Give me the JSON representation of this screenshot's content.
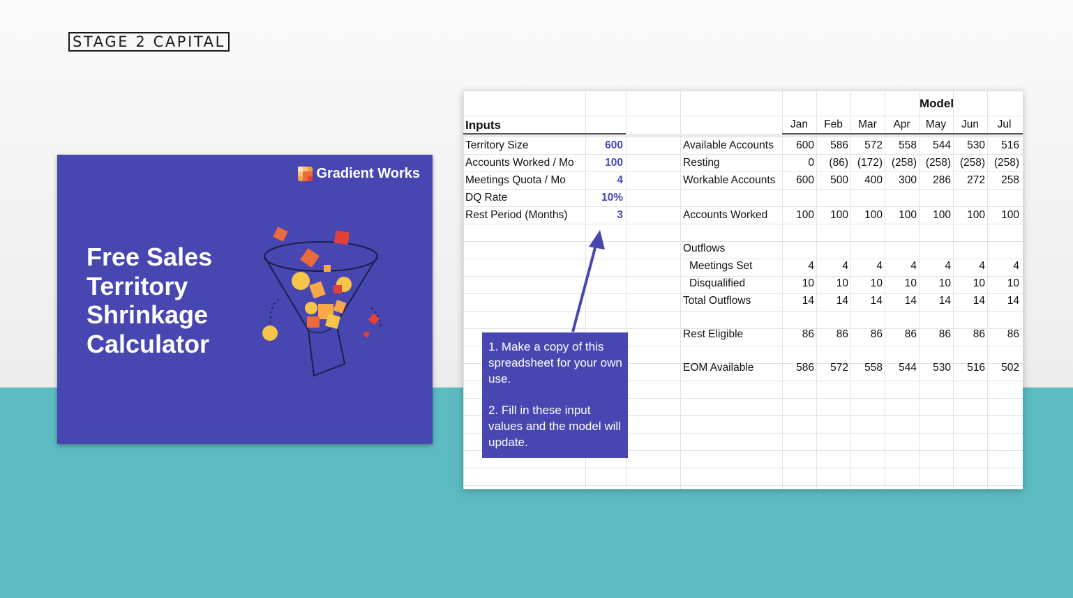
{
  "brand": {
    "logo_text": "STAGE 2 CAPITAL"
  },
  "card": {
    "brand_name": "Gradient Works",
    "title_lines": [
      "Free Sales",
      "Territory",
      "Shrinkage",
      "Calculator"
    ],
    "icons": [
      "gradient-works-logo-icon",
      "funnel-illustration"
    ],
    "background_color": "#4846b0"
  },
  "sheet": {
    "inputs_header": "Inputs",
    "model_header": "Model",
    "inputs": [
      {
        "label": "Territory Size",
        "value": "600"
      },
      {
        "label": "Accounts Worked / Mo",
        "value": "100"
      },
      {
        "label": "Meetings Quota / Mo",
        "value": "4"
      },
      {
        "label": "DQ Rate",
        "value": "10%"
      },
      {
        "label": "Rest Period (Months)",
        "value": "3"
      }
    ],
    "months": [
      "Jan",
      "Feb",
      "Mar",
      "Apr",
      "May",
      "Jun",
      "Jul"
    ],
    "model_rows": [
      {
        "label": "Available Accounts",
        "indent": false,
        "values": [
          "600",
          "586",
          "572",
          "558",
          "544",
          "530",
          "516"
        ]
      },
      {
        "label": "Resting",
        "indent": false,
        "values": [
          "0",
          "(86)",
          "(172)",
          "(258)",
          "(258)",
          "(258)",
          "(258)"
        ]
      },
      {
        "label": "Workable Accounts",
        "indent": false,
        "values": [
          "600",
          "500",
          "400",
          "300",
          "286",
          "272",
          "258"
        ]
      },
      {
        "label": "Accounts Worked",
        "indent": false,
        "values": [
          "100",
          "100",
          "100",
          "100",
          "100",
          "100",
          "100"
        ]
      },
      {
        "label": "Outflows",
        "indent": false,
        "values": []
      },
      {
        "label": "Meetings Set",
        "indent": true,
        "values": [
          "4",
          "4",
          "4",
          "4",
          "4",
          "4",
          "4"
        ]
      },
      {
        "label": "Disqualified",
        "indent": true,
        "values": [
          "10",
          "10",
          "10",
          "10",
          "10",
          "10",
          "10"
        ]
      },
      {
        "label": "Total Outflows",
        "indent": false,
        "values": [
          "14",
          "14",
          "14",
          "14",
          "14",
          "14",
          "14"
        ]
      },
      {
        "label": "Rest Eligible",
        "indent": false,
        "values": [
          "86",
          "86",
          "86",
          "86",
          "86",
          "86",
          "86"
        ]
      },
      {
        "label": "EOM Available",
        "indent": false,
        "values": [
          "586",
          "572",
          "558",
          "544",
          "530",
          "516",
          "502"
        ]
      }
    ],
    "input_value_color": "#4646b8"
  },
  "note": {
    "step1": "1. Make a copy of this spreadsheet for your own use.",
    "step2": "2. Fill in these input values and the model will update."
  },
  "colors": {
    "accent_purple": "#4846b0",
    "teal_band": "#5bbbc1"
  }
}
